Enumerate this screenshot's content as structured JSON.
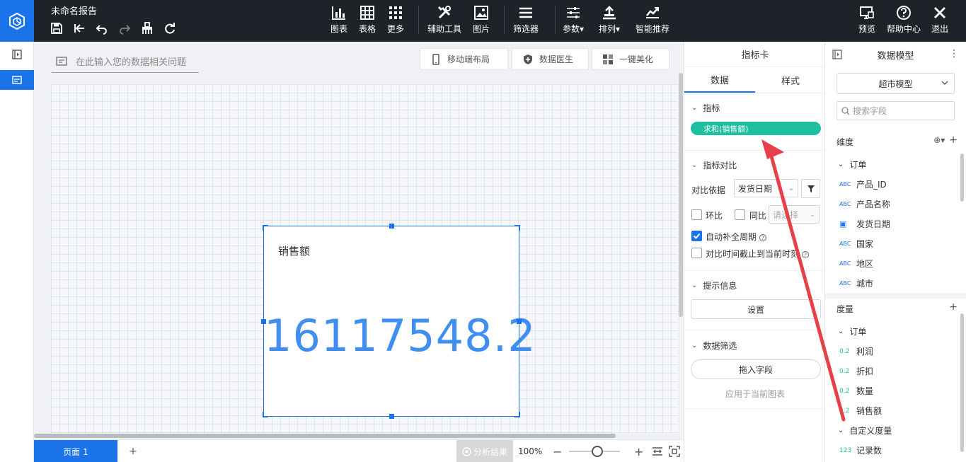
{
  "app": {
    "title": "未命名报告"
  },
  "toolbar": {
    "chart": "图表",
    "table": "表格",
    "more": "更多",
    "assist": "辅助工具",
    "image": "图片",
    "filter": "筛选器",
    "params": "参数",
    "arrange": "排列",
    "smart": "智能推荐",
    "preview": "预览",
    "help": "帮助中心",
    "exit": "退出"
  },
  "workspace": {
    "ask_placeholder": "在此输入您的数据相关问题",
    "mobile_layout": "移动端布局",
    "data_doctor": "数据医生",
    "beautify": "一键美化",
    "card": {
      "label": "销售额",
      "value": "16117548.2"
    }
  },
  "bottom": {
    "page_tab": "页面 1",
    "add": "+",
    "analysis": "分析结果",
    "zoom": "100%"
  },
  "indicator_panel": {
    "title": "指标卡",
    "tab_data": "数据",
    "tab_style": "样式",
    "section_metric": "指标",
    "metric_pill": "求和(销售额)",
    "section_compare": "指标对比",
    "compare_basis_label": "对比依据",
    "compare_basis_value": "发货日期",
    "ring_label": "环比",
    "yoy_label": "同比",
    "select_placeholder": "请选择",
    "auto_fill": "自动补全周期",
    "cutoff": "对比时间截止到当前时刻",
    "section_tip": "提示信息",
    "setup_button": "设置",
    "section_filter": "数据筛选",
    "drag_field": "拖入字段",
    "apply_chart": "应用于当前图表"
  },
  "model_panel": {
    "title": "数据模型",
    "model_select": "超市模型",
    "search_placeholder": "搜索字段",
    "dimension_title": "维度",
    "dim_group": "订单",
    "dimensions": [
      {
        "type": "ABC",
        "name": "产品_ID"
      },
      {
        "type": "ABC",
        "name": "产品名称"
      },
      {
        "type": "date",
        "name": "发货日期"
      },
      {
        "type": "ABC",
        "name": "国家"
      },
      {
        "type": "ABC",
        "name": "地区"
      },
      {
        "type": "ABC",
        "name": "城市"
      }
    ],
    "measure_title": "度量",
    "meas_group": "订单",
    "measures": [
      {
        "type": "0.2",
        "name": "利润"
      },
      {
        "type": "0.2",
        "name": "折扣"
      },
      {
        "type": "0.2",
        "name": "数量"
      },
      {
        "type": "0.2",
        "name": "销售额"
      }
    ],
    "custom_group": "自定义度量",
    "custom_measures": [
      {
        "type": "123",
        "name": "记录数"
      }
    ]
  },
  "colors": {
    "accent": "#1a73e8",
    "topbar": "#1f2329",
    "pill": "#1dbf9f",
    "kpi_value": "#3f8ef0",
    "annotation_arrow": "#e8404a"
  }
}
